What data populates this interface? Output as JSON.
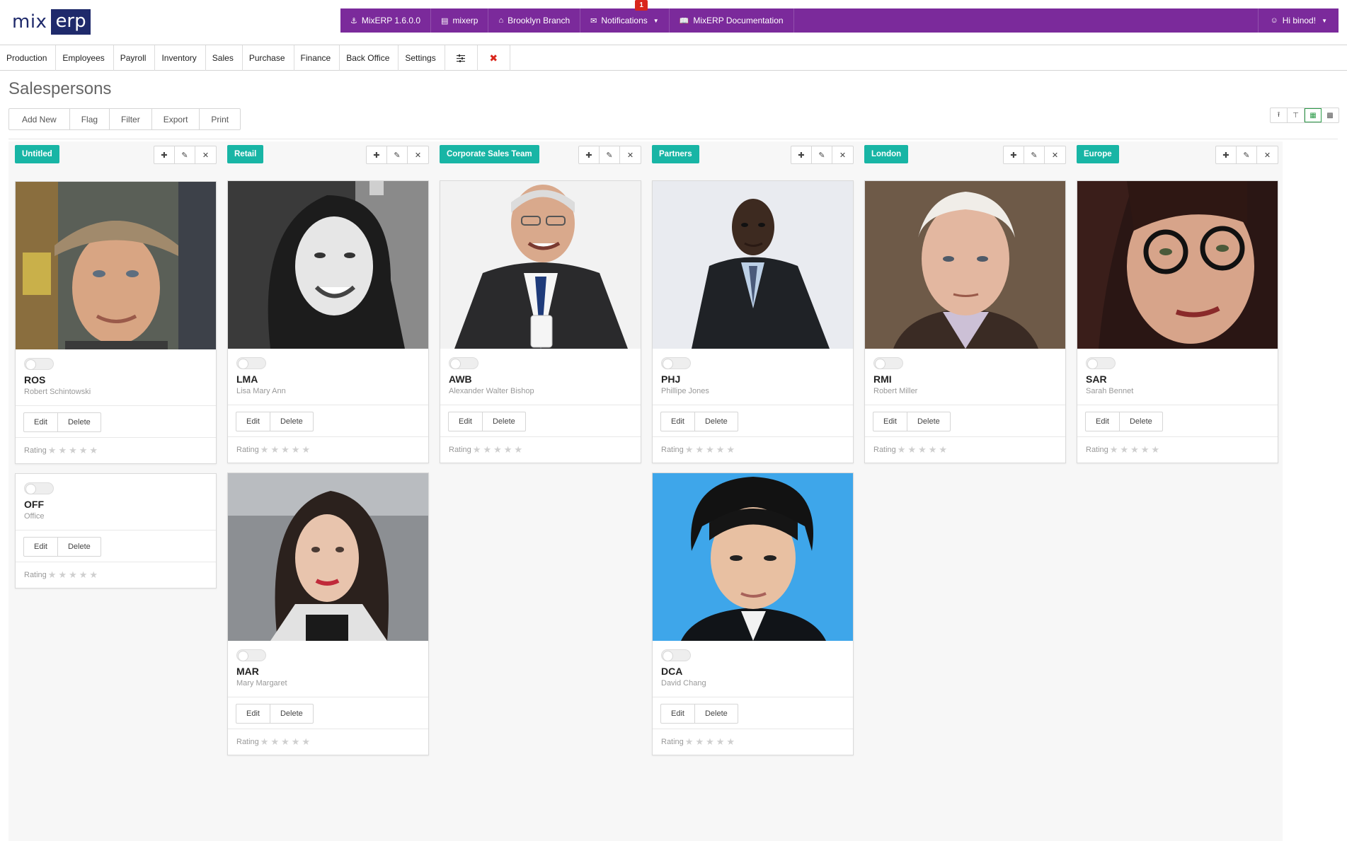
{
  "app": {
    "logo_mix": "mix",
    "logo_erp": "erp"
  },
  "topbar": {
    "version": "MixERP 1.6.0.0",
    "database": "mixerp",
    "branch": "Brooklyn Branch",
    "notifications": "Notifications",
    "notification_count": "1",
    "documentation": "MixERP Documentation",
    "user": "Hi binod!"
  },
  "menu": [
    "Production",
    "Employees",
    "Payroll",
    "Inventory",
    "Sales",
    "Purchase",
    "Finance",
    "Back Office",
    "Settings"
  ],
  "page": {
    "title": "Salespersons",
    "actions": [
      "Add New",
      "Flag",
      "Filter",
      "Export",
      "Print"
    ]
  },
  "columns": [
    {
      "tag": "Untitled",
      "cards": [
        {
          "code": "ROS",
          "name": "Robert Schintowski",
          "rating_label": "Rating",
          "edit": "Edit",
          "delete": "Delete",
          "photo": "man-cap"
        },
        {
          "code": "OFF",
          "name": "Office",
          "rating_label": "Rating",
          "edit": "Edit",
          "delete": "Delete",
          "photo": ""
        }
      ]
    },
    {
      "tag": "Retail",
      "cards": [
        {
          "code": "LMA",
          "name": "Lisa Mary Ann",
          "rating_label": "Rating",
          "edit": "Edit",
          "delete": "Delete",
          "photo": "woman-bw"
        },
        {
          "code": "MAR",
          "name": "Mary Margaret",
          "rating_label": "Rating",
          "edit": "Edit",
          "delete": "Delete",
          "photo": "woman-dark-hair"
        }
      ]
    },
    {
      "tag": "Corporate Sales Team",
      "cards": [
        {
          "code": "AWB",
          "name": "Alexander Walter Bishop",
          "rating_label": "Rating",
          "edit": "Edit",
          "delete": "Delete",
          "photo": "old-man-suit"
        }
      ]
    },
    {
      "tag": "Partners",
      "cards": [
        {
          "code": "PHJ",
          "name": "Phillipe Jones",
          "rating_label": "Rating",
          "edit": "Edit",
          "delete": "Delete",
          "photo": "man-suit"
        },
        {
          "code": "DCA",
          "name": "David Chang",
          "rating_label": "Rating",
          "edit": "Edit",
          "delete": "Delete",
          "photo": "young-man-blue"
        }
      ]
    },
    {
      "tag": "London",
      "cards": [
        {
          "code": "RMI",
          "name": "Robert Miller",
          "rating_label": "Rating",
          "edit": "Edit",
          "delete": "Delete",
          "photo": "old-man"
        }
      ]
    },
    {
      "tag": "Europe",
      "cards": [
        {
          "code": "SAR",
          "name": "Sarah Bennet",
          "rating_label": "Rating",
          "edit": "Edit",
          "delete": "Delete",
          "photo": "woman-glasses"
        }
      ]
    }
  ],
  "colors": {
    "topbar": "#7b2a9b",
    "tag": "#18b5a5",
    "logo": "#1f2a6b",
    "badge": "#d9261c"
  }
}
